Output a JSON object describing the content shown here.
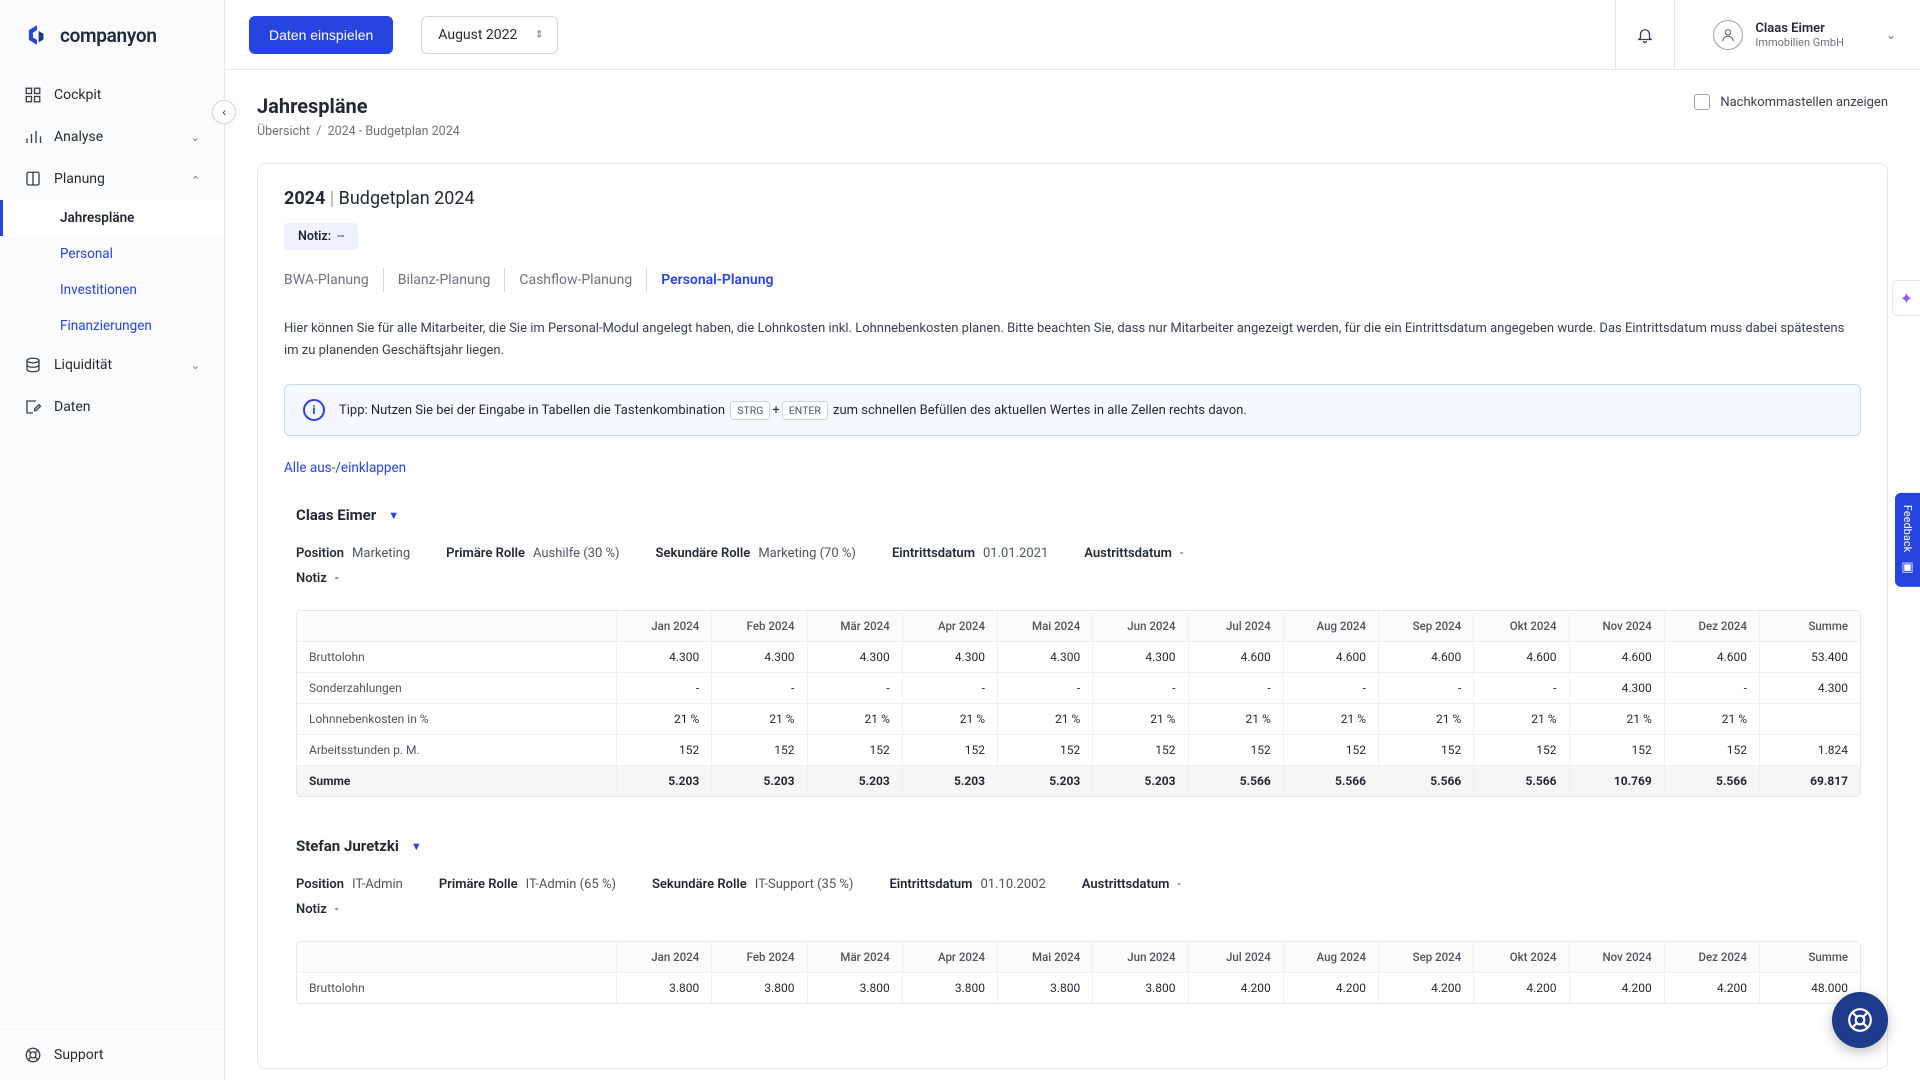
{
  "brand": "companyon",
  "topbar": {
    "import": "Daten einspielen",
    "period": "August 2022",
    "user_name": "Claas Eimer",
    "user_company": "Immobilien GmbH"
  },
  "sidebar": {
    "cockpit": "Cockpit",
    "analyse": "Analyse",
    "planung": "Planung",
    "liquiditaet": "Liquidität",
    "daten": "Daten",
    "support": "Support",
    "planung_sub": {
      "jahresplaene": "Jahrespläne",
      "personal": "Personal",
      "investitionen": "Investitionen",
      "finanzierungen": "Finanzierungen"
    }
  },
  "page": {
    "title": "Jahrespläne",
    "bc_root": "Übersicht",
    "bc_current": "2024 - Budgetplan 2024",
    "decimals_label": "Nachkommastellen anzeigen"
  },
  "plan": {
    "year": "2024",
    "name": "Budgetplan 2024",
    "notiz_label": "Notiz:",
    "notiz_value": "--",
    "tabs": {
      "bwa": "BWA-Planung",
      "bilanz": "Bilanz-Planung",
      "cashflow": "Cashflow-Planung",
      "personal": "Personal-Planung"
    },
    "desc": "Hier können Sie für alle Mitarbeiter, die Sie im Personal-Modul angelegt haben, die Lohnkosten inkl. Lohnnebenkosten planen. Bitte beachten Sie, dass nur Mitarbeiter angezeigt werden, für die ein Eintrittsdatum angegeben wurde. Das Eintrittsdatum muss dabei spätestens im zu planenden Geschäftsjahr liegen.",
    "tip_pre": "Tipp: Nutzen Sie bei der Eingabe in Tabellen die Tastenkombination",
    "tip_kbd1": "STRG",
    "tip_plus": "+",
    "tip_kbd2": "ENTER",
    "tip_post": "zum schnellen Befüllen des aktuellen Wertes in alle Zellen rechts davon.",
    "toggle_all": "Alle aus-/einklappen"
  },
  "labels": {
    "position": "Position",
    "primary": "Primäre Rolle",
    "secondary": "Sekundäre Rolle",
    "entry": "Eintrittsdatum",
    "exit": "Austrittsdatum",
    "notiz": "Notiz"
  },
  "months": [
    "Jan 2024",
    "Feb 2024",
    "Mär 2024",
    "Apr 2024",
    "Mai 2024",
    "Jun 2024",
    "Jul 2024",
    "Aug 2024",
    "Sep 2024",
    "Okt 2024",
    "Nov 2024",
    "Dez 2024"
  ],
  "sum_label": "Summe",
  "row_labels": {
    "brutto": "Bruttolohn",
    "sonder": "Sonderzahlungen",
    "lnk": "Lohnnebenkosten in %",
    "hours": "Arbeitsstunden p. M.",
    "summe": "Summe"
  },
  "employees": [
    {
      "name": "Claas Eimer",
      "position": "Marketing",
      "primary": "Aushilfe (30 %)",
      "secondary": "Marketing (70 %)",
      "entry": "01.01.2021",
      "exit": "-",
      "notiz": "-",
      "rows": {
        "brutto": [
          "4.300",
          "4.300",
          "4.300",
          "4.300",
          "4.300",
          "4.300",
          "4.600",
          "4.600",
          "4.600",
          "4.600",
          "4.600",
          "4.600"
        ],
        "brutto_total": "53.400",
        "sonder": [
          "-",
          "-",
          "-",
          "-",
          "-",
          "-",
          "-",
          "-",
          "-",
          "-",
          "4.300",
          "-"
        ],
        "sonder_total": "4.300",
        "lnk": [
          "21 %",
          "21 %",
          "21 %",
          "21 %",
          "21 %",
          "21 %",
          "21 %",
          "21 %",
          "21 %",
          "21 %",
          "21 %",
          "21 %"
        ],
        "lnk_total": "",
        "hours": [
          "152",
          "152",
          "152",
          "152",
          "152",
          "152",
          "152",
          "152",
          "152",
          "152",
          "152",
          "152"
        ],
        "hours_total": "1.824",
        "summe": [
          "5.203",
          "5.203",
          "5.203",
          "5.203",
          "5.203",
          "5.203",
          "5.566",
          "5.566",
          "5.566",
          "5.566",
          "10.769",
          "5.566"
        ],
        "summe_total": "69.817"
      }
    },
    {
      "name": "Stefan Juretzki",
      "position": "IT-Admin",
      "primary": "IT-Admin (65 %)",
      "secondary": "IT-Support (35 %)",
      "entry": "01.10.2002",
      "exit": "-",
      "notiz": "-",
      "rows": {
        "brutto": [
          "3.800",
          "3.800",
          "3.800",
          "3.800",
          "3.800",
          "3.800",
          "4.200",
          "4.200",
          "4.200",
          "4.200",
          "4.200",
          "4.200"
        ],
        "brutto_total": "48.000"
      }
    }
  ],
  "misc": {
    "feedback": "Feedback"
  }
}
